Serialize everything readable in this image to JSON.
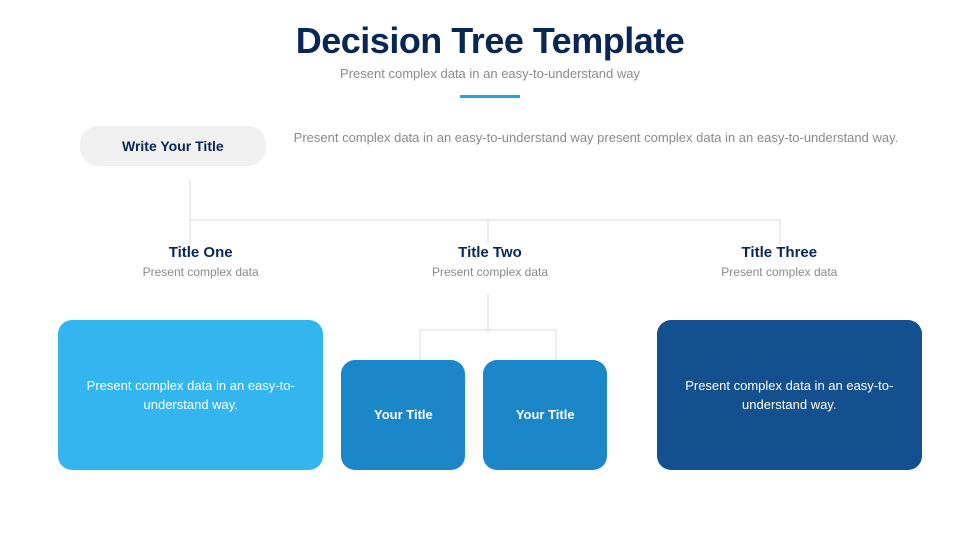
{
  "header": {
    "title": "Decision Tree Template",
    "subtitle": "Present complex data in an easy-to-understand way"
  },
  "root": {
    "label": "Write Your Title",
    "description": "Present complex data in an easy-to-understand way present complex data in an easy-to-understand way."
  },
  "branches": [
    {
      "title": "Title One",
      "subtitle": "Present complex data"
    },
    {
      "title": "Title Two",
      "subtitle": "Present complex data"
    },
    {
      "title": "Title Three",
      "subtitle": "Present complex data"
    }
  ],
  "cards": {
    "left": "Present complex data in an easy-to-understand way.",
    "midA": "Your Title",
    "midB": "Your Title",
    "right": "Present complex data in an easy-to-understand way."
  }
}
